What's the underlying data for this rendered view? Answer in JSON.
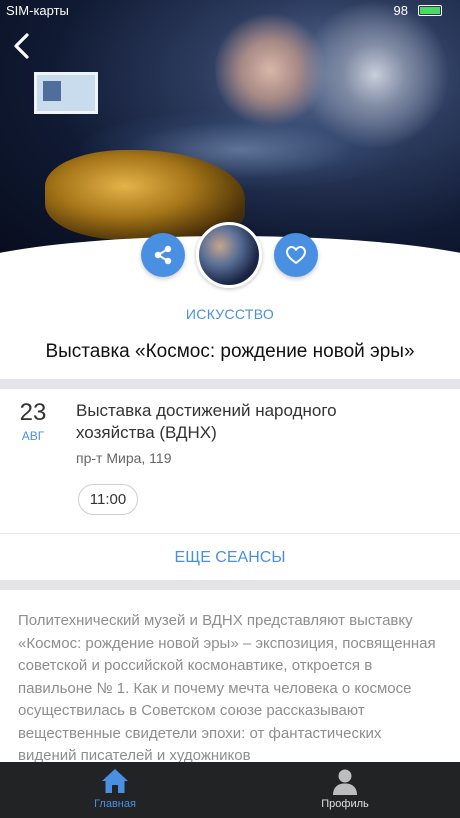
{
  "status_bar": {
    "carrier": "SIM-карты",
    "battery_percent": "98",
    "battery_level": 0.98
  },
  "header": {
    "back_icon": "chevron-left-icon",
    "share_icon": "share-icon",
    "favorite_icon": "heart-outline-icon"
  },
  "event": {
    "category": "ИСКУССТВО",
    "title": "Выставка «Космос: рождение новой эры»"
  },
  "session": {
    "day": "23",
    "month": "АВГ",
    "venue": "Выставка достижений народного хозяйства (ВДНХ)",
    "address": "пр-т Мира, 119",
    "time": "11:00"
  },
  "more_sessions_label": "ЕЩЕ СЕАНСЫ",
  "description": "Политехнический музей и ВДНХ представляют выставку «Космос: рождение новой эры» – экспозиция, посвященная советской и российской космонавтике, откроется в павильоне № 1. Как и почему мечта человека о космосе осуществилась в Советском союзе рассказывают вещественные свидетели эпохи: от фантастических видений писателей и художников",
  "tabbar": {
    "items": [
      {
        "label": "Главная",
        "icon": "home-icon",
        "active": true
      },
      {
        "label": "Профиль",
        "icon": "user-icon",
        "active": false
      }
    ]
  },
  "colors": {
    "accent": "#4a90e2",
    "tabbar_bg": "#222325",
    "battery": "#4cd964"
  }
}
